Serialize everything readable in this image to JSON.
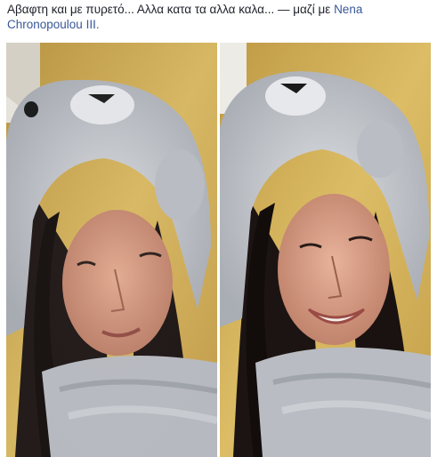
{
  "post": {
    "text": "Αβαφτη και με πυρετό... Αλλα κατα τα αλλα καλα...",
    "separator": " — ",
    "with_label": "μαζί με ",
    "tagged_user": "Nena Chronopoulou III."
  },
  "photos": [
    {
      "subject": "selfie-smiling-in-bear-hood"
    },
    {
      "subject": "selfie-laughing-in-bear-hood"
    }
  ]
}
